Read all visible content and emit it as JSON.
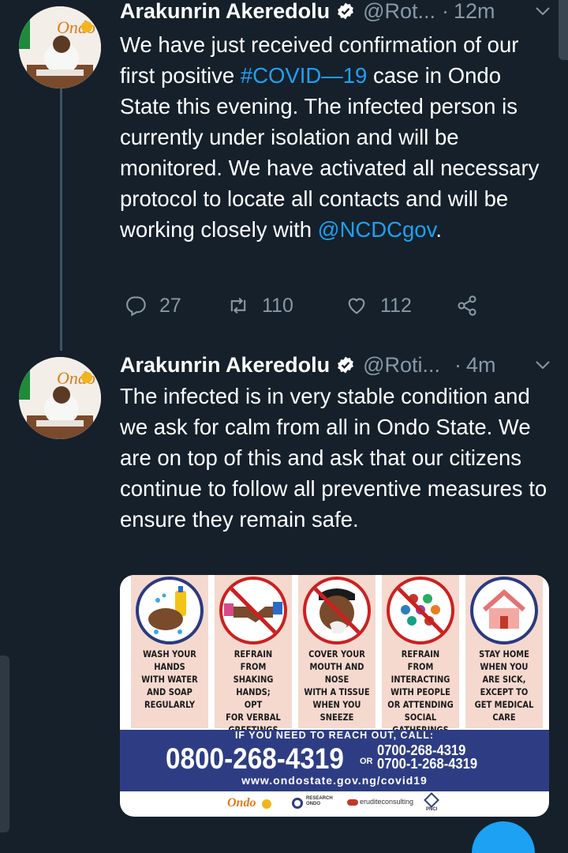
{
  "tweets": [
    {
      "name": "Arakunrin Akeredolu",
      "handle": "@Rot...",
      "dot": "·",
      "time": "12m",
      "text_parts": {
        "a": "We have just received confirmation of our first positive ",
        "hashtag": "#COVID—19",
        "b": "  case in Ondo State this evening. The infected person is currently under isolation and will be monitored. We have activated all necessary protocol to locate all contacts and will be working closely with ",
        "mention": "@NCDCgov",
        "c": "."
      },
      "replies": "27",
      "retweets": "110",
      "likes": "112"
    },
    {
      "name": "Arakunrin Akeredolu",
      "handle": "@Roti...",
      "dot": "·",
      "time": "4m",
      "text": "The infected is in very stable condition and we ask for calm from all in Ondo State. We are on top of this and ask that our citizens continue to follow all preventive measures to ensure they remain safe."
    }
  ],
  "poster": {
    "cards": [
      "WASH YOUR\nHANDS\nWITH WATER\nAND SOAP\nREGULARLY",
      "REFRAIN FROM\nSHAKING HANDS;\nOPT\nFOR VERBAL\nGREETINGS",
      "COVER YOUR\nMOUTH AND\nNOSE\nWITH A TISSUE\nWHEN YOU\nSNEEZE",
      "REFRAIN FROM\nINTERACTING\nWITH PEOPLE\nOR ATTENDING\nSOCIAL\nGATHERINGS",
      "STAY HOME\nWHEN YOU\nARE SICK,\nEXCEPT TO\nGET MEDICAL\nCARE"
    ],
    "reach_out": "IF YOU NEED TO REACH OUT, CALL:",
    "main_number": "0800-268-4319",
    "or": "OR",
    "alt_number_1": "0700-268-4319",
    "alt_number_2": "0700-1-268-4319",
    "website": "www.ondostate.gov.ng/covid19",
    "logos": {
      "ondo": "Ondo",
      "research": "RESEARCH\nONDO",
      "erudit": "eruditeconsulting",
      "pnc": "PNCI"
    }
  },
  "avatar_logo": "Ondo",
  "colors": {
    "background": "#15202b",
    "link": "#1da1f2",
    "muted": "#8899a6",
    "banner": "#2e3d83",
    "card": "#f5d9cf",
    "prohibit": "#cc2020"
  },
  "icons": [
    "verified-badge-icon",
    "chevron-down-icon",
    "reply-icon",
    "retweet-icon",
    "like-icon",
    "share-icon"
  ]
}
